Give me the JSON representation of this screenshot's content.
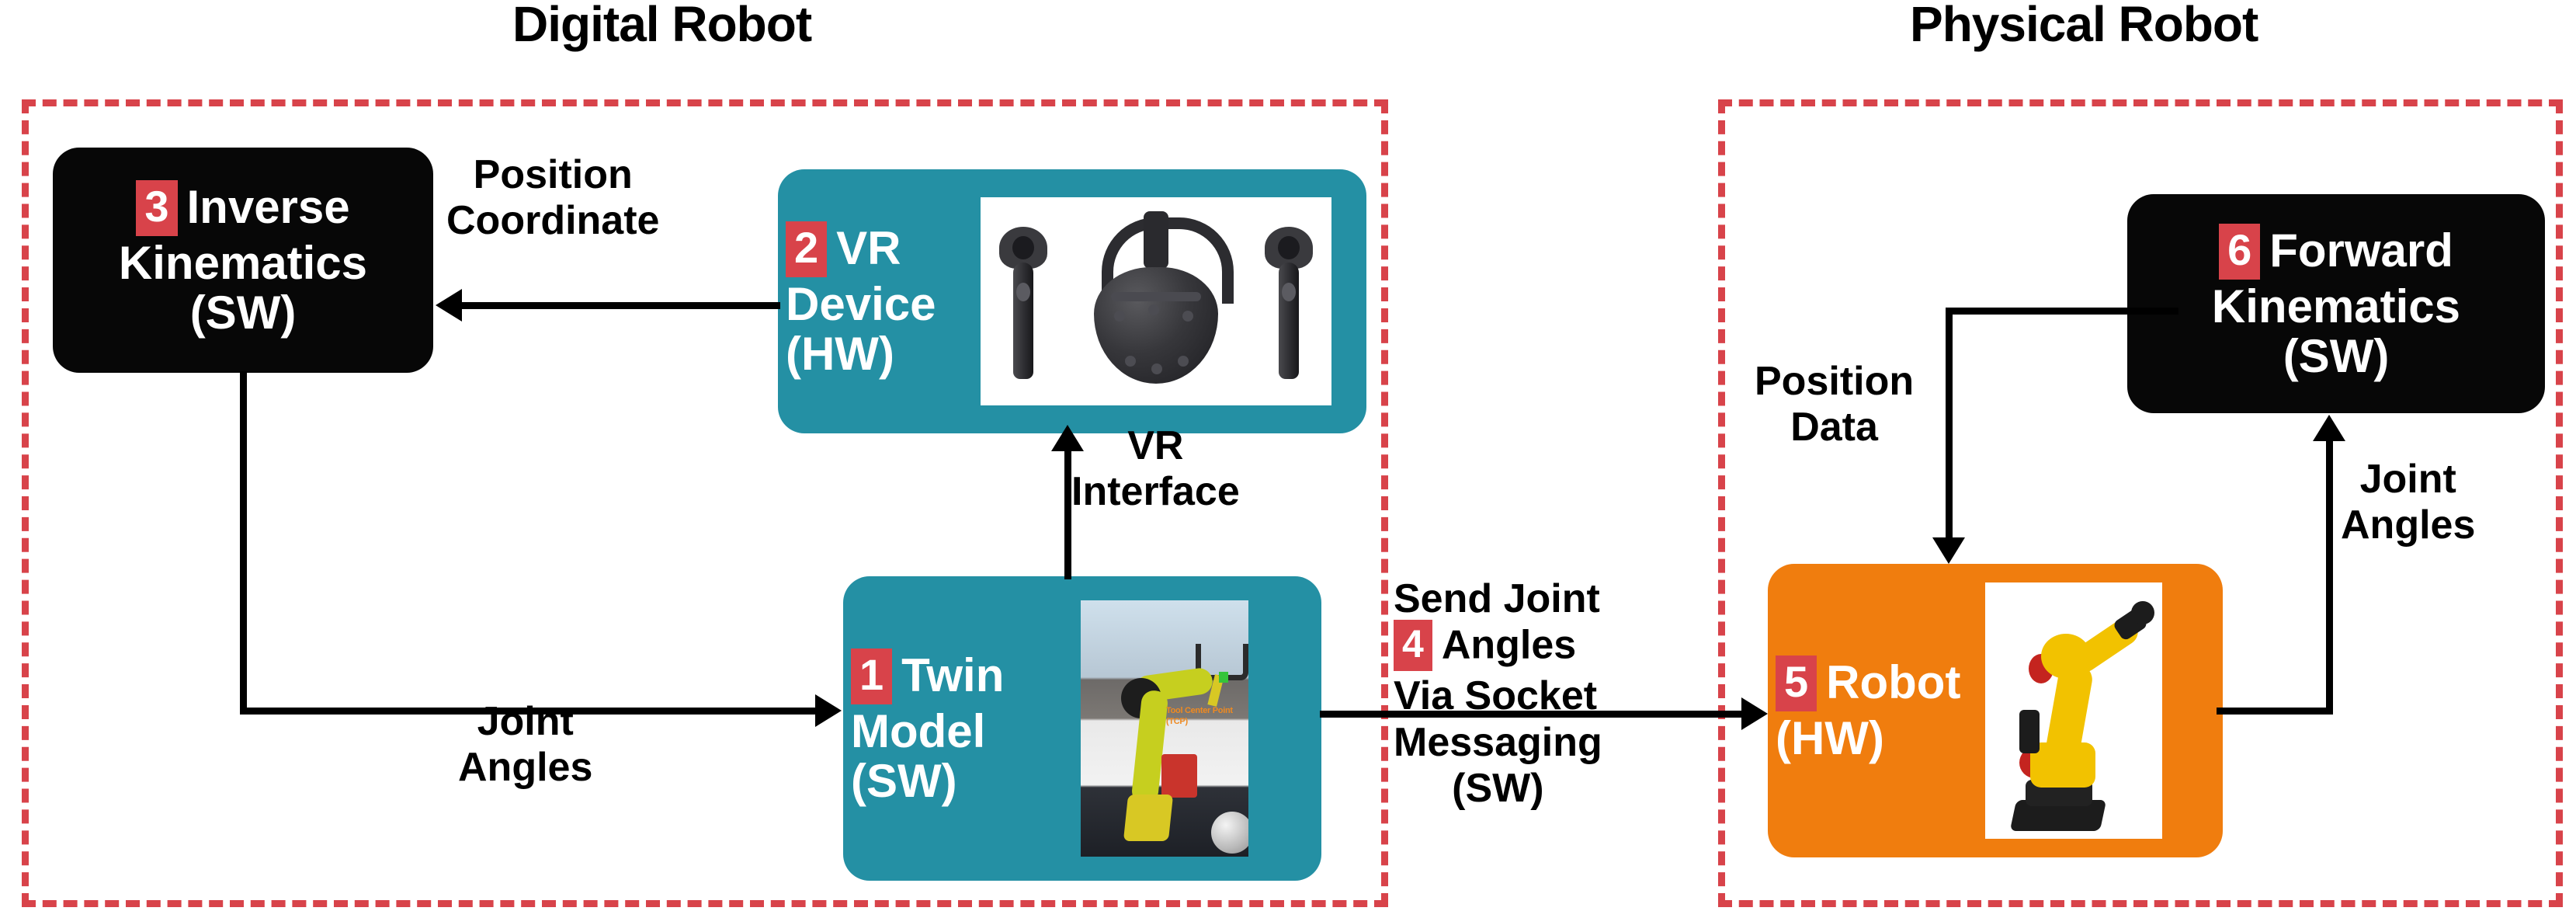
{
  "diagram": {
    "title_left": "Digital Robot",
    "title_right": "Physical Robot",
    "accent_red": "#D8434A",
    "teal": "#2490A4",
    "orange": "#F07D0E",
    "black": "#070707"
  },
  "nodes": {
    "inverse_kinematics": {
      "number": "3",
      "line1": "Inverse",
      "line2": "Kinematics",
      "line3": "(SW)",
      "color": "#070707",
      "type": "SW"
    },
    "vr_device": {
      "number": "2",
      "line1": "VR",
      "line2": "Device",
      "line3": "(HW)",
      "color": "#2490A4",
      "type": "HW",
      "image": "vr-headset-and-controllers"
    },
    "twin_model": {
      "number": "1",
      "line1": "Twin",
      "line2": "Model",
      "line3": "(SW)",
      "color": "#2490A4",
      "type": "SW",
      "image": "simulated-robot-arm-scene",
      "image_caption_line1": "Tool Center",
      "image_caption_line2": "Point (TCP)"
    },
    "robot": {
      "number": "5",
      "line1": "Robot",
      "line2": "(HW)",
      "color": "#F07D0E",
      "type": "HW",
      "image": "industrial-robot-arm"
    },
    "forward_kinematics": {
      "number": "6",
      "line1": "Forward",
      "line2": "Kinematics",
      "line3": "(SW)",
      "color": "#070707",
      "type": "SW"
    }
  },
  "edges": {
    "position_coordinate": {
      "line1": "Position",
      "line2": "Coordinate",
      "direction": "left",
      "from": "vr_device",
      "to": "inverse_kinematics"
    },
    "vr_interface": {
      "line1": "VR",
      "line2": "Interface",
      "direction": "up",
      "from": "twin_model",
      "to": "vr_device"
    },
    "joint_angles_left": {
      "line1": "Joint",
      "line2": "Angles",
      "direction": "right",
      "from": "inverse_kinematics",
      "to": "twin_model"
    },
    "send_joint_angles": {
      "number": "4",
      "line1": "Send Joint",
      "line2": "Angles",
      "line3": "Via Socket",
      "line4": "Messaging",
      "line5": "(SW)",
      "direction": "right",
      "from": "twin_model",
      "to": "robot"
    },
    "position_data": {
      "line1": "Position",
      "line2": "Data",
      "direction": "down",
      "from": "forward_kinematics",
      "to": "robot"
    },
    "joint_angles_right": {
      "line1": "Joint",
      "line2": "Angles",
      "direction": "up",
      "from": "robot",
      "to": "forward_kinematics"
    }
  }
}
